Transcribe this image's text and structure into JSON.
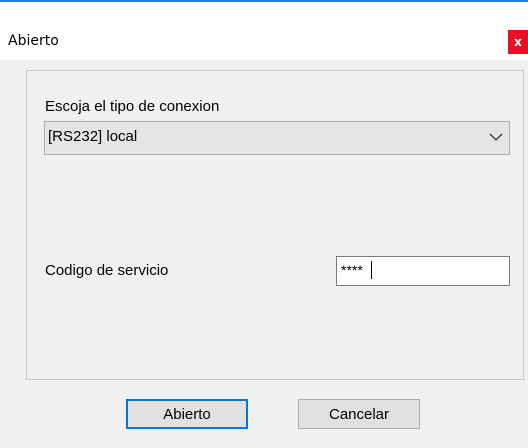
{
  "window": {
    "title": "Abierto",
    "close_label": "x"
  },
  "form": {
    "connection_label": "Escoja el tipo de conexion",
    "connection_selected": "[RS232] local",
    "service_code_label": "Codigo de servicio",
    "service_code_value": "****"
  },
  "buttons": {
    "ok_label": "Abierto",
    "cancel_label": "Cancelar"
  },
  "colors": {
    "accent": "#0078d7",
    "close": "#e81123",
    "window_bg": "#f0f0f0"
  },
  "icons": {
    "dropdown": "chevron-down-icon",
    "close": "close-icon"
  }
}
